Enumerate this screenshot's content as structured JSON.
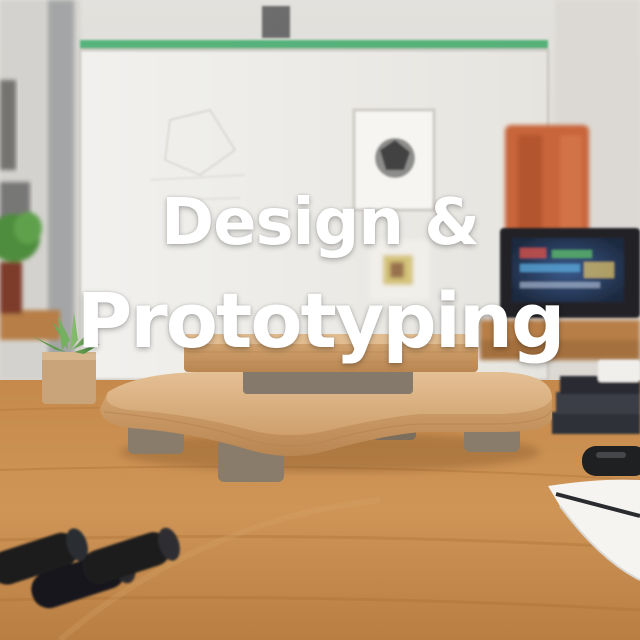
{
  "headline": {
    "line1": "Design &",
    "line2": "Prototyping"
  },
  "colors": {
    "headline_text": "#ffffff",
    "desk_wood": "#c98f4e",
    "prototype_wood": "#d8ae7d",
    "wall": "#e9e6e1",
    "monitor_bezel_accent": "#3aa866",
    "plant_green": "#5a9a4a",
    "orange_object": "#c8653a"
  },
  "objects": [
    "wall-background-blurred",
    "whiteboard-blurred",
    "framed-picture-icon",
    "orange-device",
    "monitor-screen",
    "potted-plant-left",
    "succulent-pot",
    "stacked-books",
    "marker-pen",
    "notepad",
    "black-cylinders",
    "wooden-prototype-stand"
  ]
}
